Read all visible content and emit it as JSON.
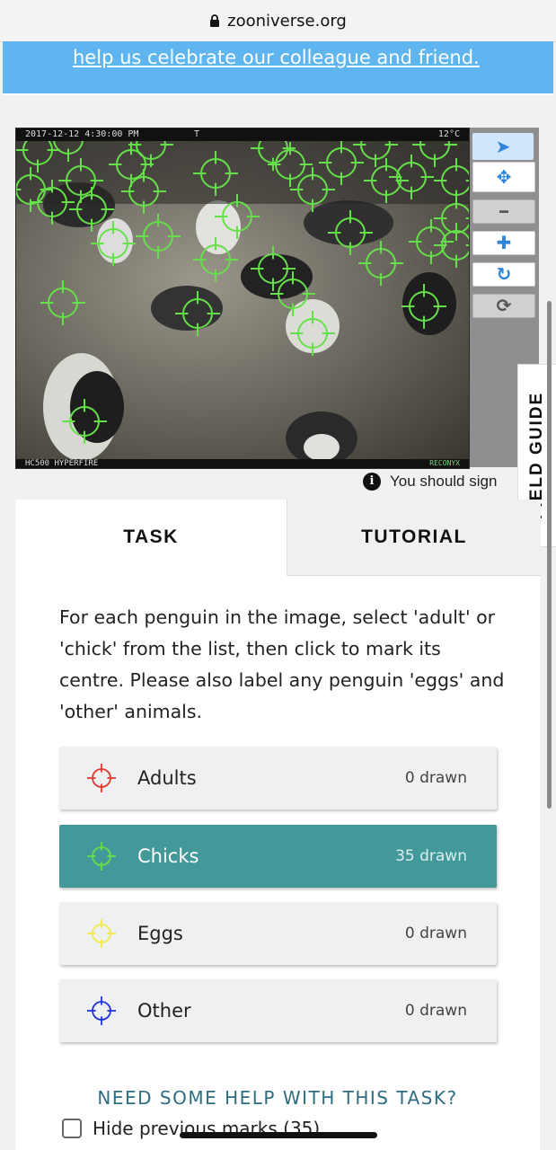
{
  "browser": {
    "url": "zooniverse.org"
  },
  "banner": {
    "link_text": "help us celebrate our colleague and friend",
    "trailing": "."
  },
  "viewer": {
    "timestamp": "2017-12-12  4:30:00 PM",
    "marker_t": "T",
    "temperature": "12°C",
    "camera_model": "HC500 HYPERFIRE",
    "brand": "RECONYX"
  },
  "tools": [
    {
      "name": "pointer-icon",
      "glyph": "➤"
    },
    {
      "name": "move-icon",
      "glyph": "✥"
    },
    {
      "name": "zoom-out-icon",
      "glyph": "━"
    },
    {
      "name": "zoom-in-icon",
      "glyph": "✚"
    },
    {
      "name": "rotate-icon",
      "glyph": "↻"
    },
    {
      "name": "reset-icon",
      "glyph": "⟳"
    }
  ],
  "field_guide": {
    "label": "FIELD GUIDE"
  },
  "sign_in_note": {
    "text": "You should sign"
  },
  "tabs": {
    "task": "TASK",
    "tutorial": "TUTORIAL"
  },
  "instructions": "For each penguin in the image, select 'adult' or 'chick' from the list, then click to mark its centre. Please also label any penguin 'eggs' and 'other' animals.",
  "choices": [
    {
      "label": "Adults",
      "count": "0 drawn",
      "color": "#e03a2f"
    },
    {
      "label": "Chicks",
      "count": "35 drawn",
      "color": "#66e04a"
    },
    {
      "label": "Eggs",
      "count": "0 drawn",
      "color": "#f2ea4a"
    },
    {
      "label": "Other",
      "count": "0 drawn",
      "color": "#2233dd"
    }
  ],
  "help_link": "NEED SOME HELP WITH THIS TASK?",
  "hide_marks": "Hide previous marks (35)"
}
